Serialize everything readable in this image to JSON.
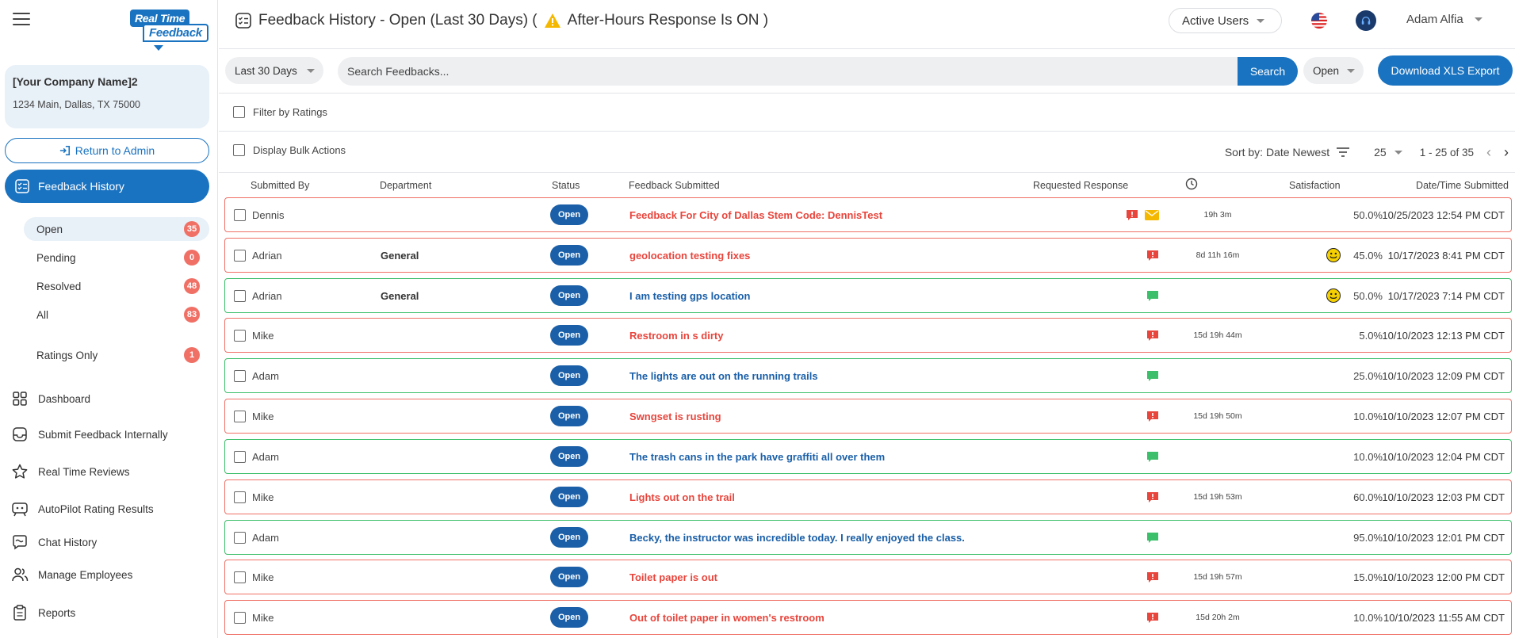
{
  "sidebar": {
    "logo_line1": "Real Time",
    "logo_line2": "Feedback",
    "company_name": "[Your Company Name]2",
    "company_address": "1234 Main, Dallas, TX 75000",
    "return_label": "Return to Admin",
    "active_nav": "Feedback History",
    "sub_items": [
      {
        "label": "Open",
        "count": "35"
      },
      {
        "label": "Pending",
        "count": "0"
      },
      {
        "label": "Resolved",
        "count": "48"
      },
      {
        "label": "All",
        "count": "83"
      },
      {
        "label": "Ratings Only",
        "count": "1"
      }
    ],
    "nav_items": [
      {
        "label": "Dashboard",
        "icon": "dashboard-icon"
      },
      {
        "label": "Submit Feedback Internally",
        "icon": "inbox-icon"
      },
      {
        "label": "Real Time Reviews",
        "icon": "star-icon"
      },
      {
        "label": "AutoPilot Rating Results",
        "icon": "autopilot-icon"
      },
      {
        "label": "Chat History",
        "icon": "chat-icon"
      },
      {
        "label": "Manage Employees",
        "icon": "employees-icon"
      },
      {
        "label": "Reports",
        "icon": "clipboard-icon"
      }
    ]
  },
  "header": {
    "title_prefix": "Feedback History - Open (Last 30 Days) (",
    "title_suffix": "After-Hours Response Is ON )",
    "active_users": "Active Users",
    "user_name": "Adam Alfia"
  },
  "toolbar": {
    "range": "Last 30 Days",
    "search_placeholder": "Search Feedbacks...",
    "search_label": "Search",
    "status": "Open",
    "export_label": "Download XLS Export"
  },
  "filters": {
    "ratings_label": "Filter by Ratings",
    "bulk_label": "Display Bulk Actions",
    "sort_label": "Sort by: Date Newest",
    "per_page": "25",
    "range_label": "1 - 25 of 35"
  },
  "columns": {
    "submitted_by": "Submitted By",
    "department": "Department",
    "status": "Status",
    "feedback": "Feedback Submitted",
    "requested_response": "Requested Response",
    "satisfaction": "Satisfaction",
    "date": "Date/Time Submitted"
  },
  "rows": [
    {
      "name": "Dennis",
      "dept": "",
      "status": "Open",
      "feedback": "Feedback For City of Dallas Stem Code: DennisTest",
      "tone": "red",
      "icons": [
        "flag",
        "mail"
      ],
      "time": "19h 3m",
      "satisfaction": "50.0%",
      "smiley": false,
      "date": "10/25/2023 12:54 PM CDT"
    },
    {
      "name": "Adrian",
      "dept": "General",
      "status": "Open",
      "feedback": "geolocation testing fixes",
      "tone": "red",
      "icons": [
        "flag"
      ],
      "time": "8d 11h 16m",
      "satisfaction": "45.0%",
      "smiley": true,
      "date": "10/17/2023 8:41 PM CDT"
    },
    {
      "name": "Adrian",
      "dept": "General",
      "status": "Open",
      "feedback": "I am testing gps location",
      "tone": "blue",
      "icons": [
        "chat"
      ],
      "time": "",
      "satisfaction": "50.0%",
      "smiley": true,
      "date": "10/17/2023 7:14 PM CDT"
    },
    {
      "name": "Mike",
      "dept": "",
      "status": "Open",
      "feedback": "Restroom in s dirty",
      "tone": "red",
      "icons": [
        "flag"
      ],
      "time": "15d 19h 44m",
      "satisfaction": "5.0%",
      "smiley": false,
      "date": "10/10/2023 12:13 PM CDT"
    },
    {
      "name": "Adam",
      "dept": "",
      "status": "Open",
      "feedback": "The lights are out on the running trails",
      "tone": "blue",
      "icons": [
        "chat"
      ],
      "time": "",
      "satisfaction": "25.0%",
      "smiley": false,
      "date": "10/10/2023 12:09 PM CDT"
    },
    {
      "name": "Mike",
      "dept": "",
      "status": "Open",
      "feedback": "Swngset is rusting",
      "tone": "red",
      "icons": [
        "flag"
      ],
      "time": "15d 19h 50m",
      "satisfaction": "10.0%",
      "smiley": false,
      "date": "10/10/2023 12:07 PM CDT"
    },
    {
      "name": "Adam",
      "dept": "",
      "status": "Open",
      "feedback": "The trash cans in the park have graffiti all over them",
      "tone": "blue",
      "icons": [
        "chat"
      ],
      "time": "",
      "satisfaction": "10.0%",
      "smiley": false,
      "date": "10/10/2023 12:04 PM CDT"
    },
    {
      "name": "Mike",
      "dept": "",
      "status": "Open",
      "feedback": "Lights out on the trail",
      "tone": "red",
      "icons": [
        "flag"
      ],
      "time": "15d 19h 53m",
      "satisfaction": "60.0%",
      "smiley": false,
      "date": "10/10/2023 12:03 PM CDT"
    },
    {
      "name": "Adam",
      "dept": "",
      "status": "Open",
      "feedback": "Becky, the instructor was incredible today. I really enjoyed the class.",
      "tone": "blue",
      "icons": [
        "chat"
      ],
      "time": "",
      "satisfaction": "95.0%",
      "smiley": false,
      "date": "10/10/2023 12:01 PM CDT"
    },
    {
      "name": "Mike",
      "dept": "",
      "status": "Open",
      "feedback": "Toilet paper is out",
      "tone": "red",
      "icons": [
        "flag"
      ],
      "time": "15d 19h 57m",
      "satisfaction": "15.0%",
      "smiley": false,
      "date": "10/10/2023 12:00 PM CDT"
    },
    {
      "name": "Mike",
      "dept": "",
      "status": "Open",
      "feedback": "Out of toilet paper in women's restroom",
      "tone": "red",
      "icons": [
        "flag"
      ],
      "time": "15d 20h 2m",
      "satisfaction": "10.0%",
      "smiley": false,
      "date": "10/10/2023 11:55 AM CDT"
    }
  ],
  "colors": {
    "primary": "#1a73c0",
    "alert_red": "#e8453c",
    "resolved_green": "#3cbf6a",
    "badge": "#f07066",
    "mail_yellow": "#f5b800"
  }
}
